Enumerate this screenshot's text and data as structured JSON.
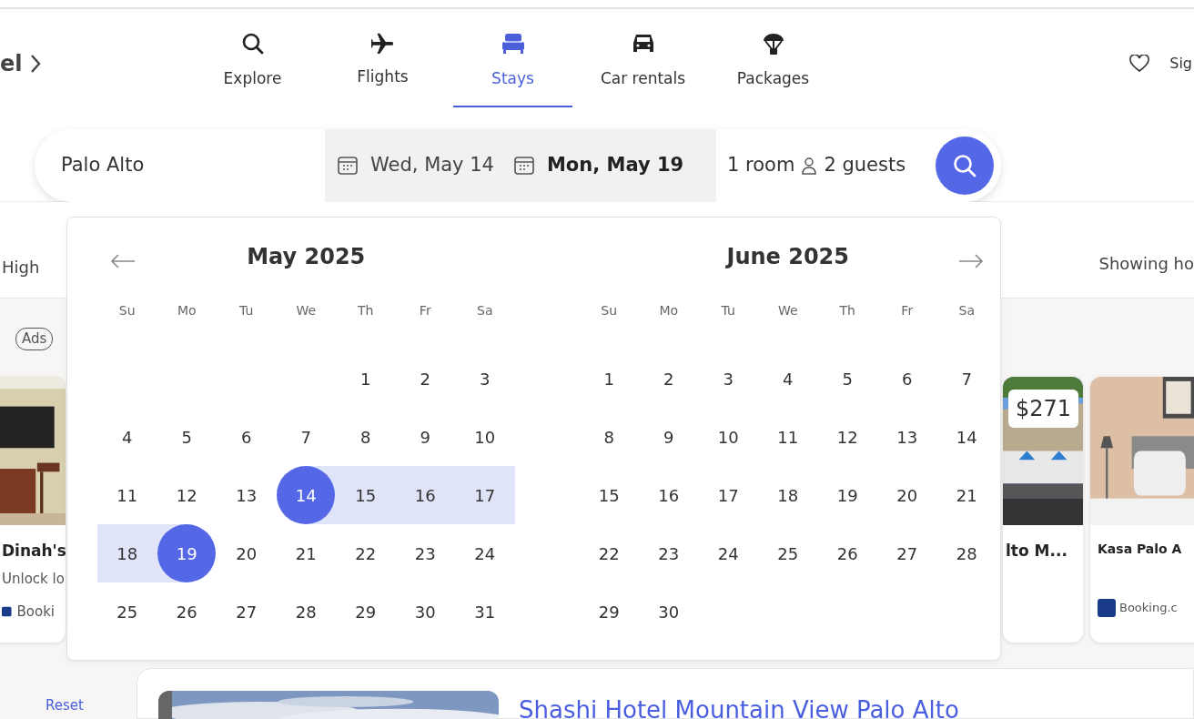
{
  "breadcrumb": {
    "text": "el"
  },
  "tabs": [
    {
      "label": "Explore",
      "selected": false
    },
    {
      "label": "Flights",
      "selected": false
    },
    {
      "label": "Stays",
      "selected": true
    },
    {
      "label": "Car rentals",
      "selected": false
    },
    {
      "label": "Packages",
      "selected": false
    }
  ],
  "account": {
    "sign_in": "Sig"
  },
  "search": {
    "destination": "Palo Alto",
    "check_in": {
      "value": "Wed, May 14",
      "active": false
    },
    "check_out": {
      "value": "Mon, May 19",
      "active": true
    },
    "rooms": "1 room",
    "guests": "2 guests"
  },
  "filter_bar": {
    "price_label": "High",
    "results_text": "Showing ho"
  },
  "ads": {
    "label": "Ads",
    "cards": [
      {
        "title": "Dinah's",
        "subtitle": "Unlock lo",
        "source": "Booki"
      },
      {
        "title": "lto M...",
        "price": "$271"
      },
      {
        "title": "Kasa Palo A",
        "source": "Booking.c"
      }
    ]
  },
  "reset": "Reset",
  "listing": {
    "title": "Shashi Hotel Mountain View Palo Alto"
  },
  "calendar": {
    "months": [
      {
        "title": "May 2025",
        "weekdays": [
          "Su",
          "Mo",
          "Tu",
          "We",
          "Th",
          "Fr",
          "Sa"
        ],
        "weeks": [
          [
            {
              "label": "1",
              "selected": false,
              "in_range": false
            },
            {
              "label": "2",
              "selected": false,
              "in_range": false
            },
            {
              "label": "3",
              "selected": false,
              "in_range": false
            }
          ],
          [
            {
              "label": "4",
              "selected": false,
              "in_range": false
            },
            {
              "label": "5",
              "selected": false,
              "in_range": false
            },
            {
              "label": "6",
              "selected": false,
              "in_range": false
            },
            {
              "label": "7",
              "selected": false,
              "in_range": false
            },
            {
              "label": "8",
              "selected": false,
              "in_range": false
            },
            {
              "label": "9",
              "selected": false,
              "in_range": false
            },
            {
              "label": "10",
              "selected": false,
              "in_range": false
            }
          ],
          [
            {
              "label": "11",
              "selected": false,
              "in_range": false
            },
            {
              "label": "12",
              "selected": false,
              "in_range": false
            },
            {
              "label": "13",
              "selected": false,
              "in_range": false
            },
            {
              "label": "14",
              "selected": true,
              "in_range": true
            },
            {
              "label": "15",
              "selected": false,
              "in_range": true
            },
            {
              "label": "16",
              "selected": false,
              "in_range": true
            },
            {
              "label": "17",
              "selected": false,
              "in_range": true
            }
          ],
          [
            {
              "label": "18",
              "selected": false,
              "in_range": true
            },
            {
              "label": "19",
              "selected": true,
              "in_range": true
            },
            {
              "label": "20",
              "selected": false,
              "in_range": false
            },
            {
              "label": "21",
              "selected": false,
              "in_range": false
            },
            {
              "label": "22",
              "selected": false,
              "in_range": false
            },
            {
              "label": "23",
              "selected": false,
              "in_range": false
            },
            {
              "label": "24",
              "selected": false,
              "in_range": false
            }
          ],
          [
            {
              "label": "25",
              "selected": false,
              "in_range": false
            },
            {
              "label": "26",
              "selected": false,
              "in_range": false
            },
            {
              "label": "27",
              "selected": false,
              "in_range": false
            },
            {
              "label": "28",
              "selected": false,
              "in_range": false
            },
            {
              "label": "29",
              "selected": false,
              "in_range": false
            },
            {
              "label": "30",
              "selected": false,
              "in_range": false
            },
            {
              "label": "31",
              "selected": false,
              "in_range": false
            }
          ]
        ]
      },
      {
        "title": "June 2025",
        "weekdays": [
          "Su",
          "Mo",
          "Tu",
          "We",
          "Th",
          "Fr",
          "Sa"
        ],
        "weeks": [
          [
            {
              "label": "1",
              "selected": false,
              "in_range": false
            },
            {
              "label": "2",
              "selected": false,
              "in_range": false
            },
            {
              "label": "3",
              "selected": false,
              "in_range": false
            },
            {
              "label": "4",
              "selected": false,
              "in_range": false
            },
            {
              "label": "5",
              "selected": false,
              "in_range": false
            },
            {
              "label": "6",
              "selected": false,
              "in_range": false
            },
            {
              "label": "7",
              "selected": false,
              "in_range": false
            }
          ],
          [
            {
              "label": "8",
              "selected": false,
              "in_range": false
            },
            {
              "label": "9",
              "selected": false,
              "in_range": false
            },
            {
              "label": "10",
              "selected": false,
              "in_range": false
            },
            {
              "label": "11",
              "selected": false,
              "in_range": false
            },
            {
              "label": "12",
              "selected": false,
              "in_range": false
            },
            {
              "label": "13",
              "selected": false,
              "in_range": false
            },
            {
              "label": "14",
              "selected": false,
              "in_range": false
            }
          ],
          [
            {
              "label": "15",
              "selected": false,
              "in_range": false
            },
            {
              "label": "16",
              "selected": false,
              "in_range": false
            },
            {
              "label": "17",
              "selected": false,
              "in_range": false
            },
            {
              "label": "18",
              "selected": false,
              "in_range": false
            },
            {
              "label": "19",
              "selected": false,
              "in_range": false
            },
            {
              "label": "20",
              "selected": false,
              "in_range": false
            },
            {
              "label": "21",
              "selected": false,
              "in_range": false
            }
          ],
          [
            {
              "label": "22",
              "selected": false,
              "in_range": false
            },
            {
              "label": "23",
              "selected": false,
              "in_range": false
            },
            {
              "label": "24",
              "selected": false,
              "in_range": false
            },
            {
              "label": "25",
              "selected": false,
              "in_range": false
            },
            {
              "label": "26",
              "selected": false,
              "in_range": false
            },
            {
              "label": "27",
              "selected": false,
              "in_range": false
            },
            {
              "label": "28",
              "selected": false,
              "in_range": false
            }
          ],
          [
            {
              "label": "29",
              "selected": false,
              "in_range": false
            },
            {
              "label": "30",
              "selected": false,
              "in_range": false
            }
          ]
        ]
      }
    ]
  }
}
